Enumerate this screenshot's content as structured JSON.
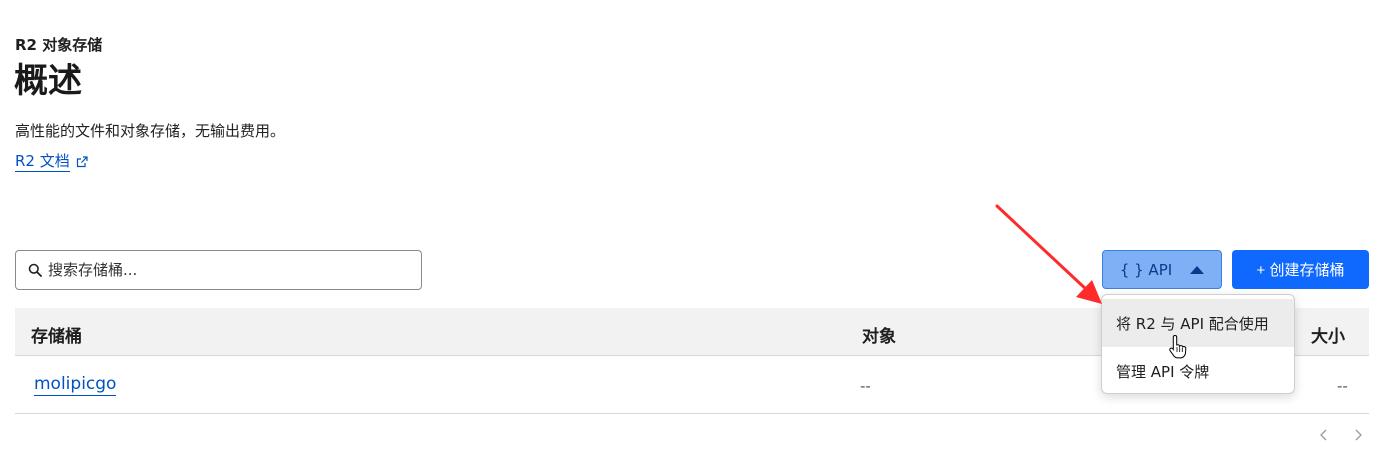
{
  "header": {
    "breadcrumb": "R2 对象存储",
    "title": "概述",
    "subtitle": "高性能的文件和对象存储，无输出费用。",
    "docs_link": "R2 文档"
  },
  "toolbar": {
    "search_placeholder": "搜索存储桶...",
    "api_button_label": "{ } API",
    "create_button_label": "+ 创建存储桶"
  },
  "api_menu": {
    "items": [
      {
        "label": "将 R2 与 API 配合使用"
      },
      {
        "label": "管理 API 令牌"
      }
    ]
  },
  "table": {
    "columns": [
      "存储桶",
      "对象",
      "大小"
    ],
    "rows": [
      {
        "name": "molipicgo",
        "objects": "--",
        "size": "--"
      }
    ]
  },
  "colors": {
    "accent": "#0f69ff",
    "link": "#0051c3",
    "annotation_arrow": "#ff2a2a"
  },
  "icons": {
    "search": "search-icon",
    "external": "external-link-icon",
    "caret": "caret-up-icon",
    "pager_prev": "chevron-left-icon",
    "pager_next": "chevron-right-icon"
  }
}
